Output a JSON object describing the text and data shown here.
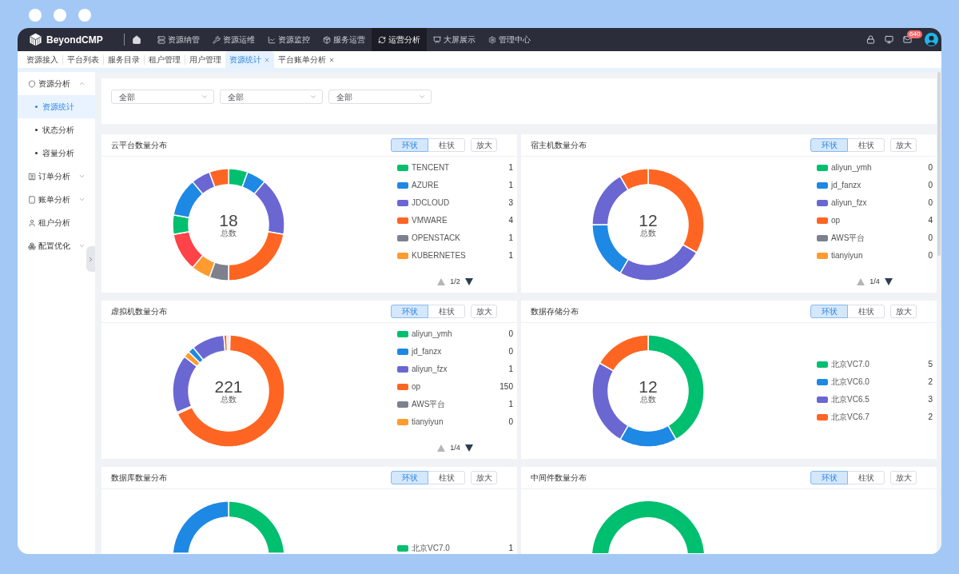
{
  "nav": {
    "logo": "BeyondCMP",
    "items": [
      {
        "label": "资源纳管",
        "selected": false
      },
      {
        "label": "资源运维",
        "selected": false
      },
      {
        "label": "资源监控",
        "selected": false
      },
      {
        "label": "服务运营",
        "selected": false
      },
      {
        "label": "运营分析",
        "selected": true
      },
      {
        "label": "大屏展示",
        "selected": false
      },
      {
        "label": "管理中心",
        "selected": false
      }
    ],
    "mail_badge": "640"
  },
  "tabs": [
    {
      "label": "资源接入",
      "selected": false,
      "closable": false
    },
    {
      "label": "平台列表",
      "selected": false,
      "closable": false
    },
    {
      "label": "服务目录",
      "selected": false,
      "closable": false
    },
    {
      "label": "租户管理",
      "selected": false,
      "closable": false
    },
    {
      "label": "用户管理",
      "selected": false,
      "closable": false
    },
    {
      "label": "资源统计",
      "selected": true,
      "closable": true
    },
    {
      "label": "平台账单分析",
      "selected": false,
      "closable": true
    }
  ],
  "sidebar": {
    "items": [
      {
        "kind": "group",
        "label": "资源分析",
        "expanded": true,
        "children": [
          {
            "label": "资源统计",
            "selected": true
          },
          {
            "label": "状态分析",
            "selected": false
          },
          {
            "label": "容量分析",
            "selected": false
          }
        ]
      },
      {
        "kind": "group",
        "label": "订单分析",
        "expanded": false
      },
      {
        "kind": "group",
        "label": "账单分析",
        "expanded": false
      },
      {
        "kind": "link",
        "label": "租户分析"
      },
      {
        "kind": "group",
        "label": "配置优化",
        "expanded": false
      }
    ]
  },
  "filters": [
    {
      "value": "全部"
    },
    {
      "value": "全部"
    },
    {
      "value": "全部"
    }
  ],
  "charts": [
    {
      "title": "云平台数量分布",
      "view_options": [
        {
          "label": "环状",
          "selected": true
        },
        {
          "label": "柱状",
          "selected": false
        }
      ],
      "zoom_button": "放大",
      "total": "18",
      "total_label": "总数",
      "legend": [
        {
          "label": "TENCENT",
          "value": "1",
          "color": "#00bf6f"
        },
        {
          "label": "AZURE",
          "value": "1",
          "color": "#1e88e5"
        },
        {
          "label": "JDCLOUD",
          "value": "3",
          "color": "#6a67d3"
        },
        {
          "label": "VMWARE",
          "value": "4",
          "color": "#ff6522"
        },
        {
          "label": "OPENSTACK",
          "value": "1",
          "color": "#7c818d"
        },
        {
          "label": "KUBERNETES",
          "value": "1",
          "color": "#ff9b2f"
        }
      ],
      "pager": {
        "text": "1/2",
        "prev_disabled": true,
        "next_disabled": false
      }
    },
    {
      "title": "宿主机数量分布",
      "view_options": [
        {
          "label": "环状",
          "selected": true
        },
        {
          "label": "柱状",
          "selected": false
        }
      ],
      "zoom_button": "放大",
      "total": "12",
      "total_label": "总数",
      "legend": [
        {
          "label": "aliyun_ymh",
          "value": "0",
          "color": "#00bf6f"
        },
        {
          "label": "jd_fanzx",
          "value": "0",
          "color": "#1e88e5"
        },
        {
          "label": "aliyun_fzx",
          "value": "0",
          "color": "#6a67d3"
        },
        {
          "label": "op",
          "value": "4",
          "color": "#ff6522"
        },
        {
          "label": "AWS平台",
          "value": "0",
          "color": "#7c818d"
        },
        {
          "label": "tianyiyun",
          "value": "0",
          "color": "#ff9b2f"
        }
      ],
      "pager": {
        "text": "1/4",
        "prev_disabled": true,
        "next_disabled": false
      }
    },
    {
      "title": "虚拟机数量分布",
      "view_options": [
        {
          "label": "环状",
          "selected": true
        },
        {
          "label": "柱状",
          "selected": false
        }
      ],
      "zoom_button": "放大",
      "total": "221",
      "total_label": "总数",
      "legend": [
        {
          "label": "aliyun_ymh",
          "value": "0",
          "color": "#00bf6f"
        },
        {
          "label": "jd_fanzx",
          "value": "0",
          "color": "#1e88e5"
        },
        {
          "label": "aliyun_fzx",
          "value": "1",
          "color": "#6a67d3"
        },
        {
          "label": "op",
          "value": "150",
          "color": "#ff6522"
        },
        {
          "label": "AWS平台",
          "value": "1",
          "color": "#7c818d"
        },
        {
          "label": "tianyiyun",
          "value": "0",
          "color": "#ff9b2f"
        }
      ],
      "pager": {
        "text": "1/4",
        "prev_disabled": true,
        "next_disabled": false
      }
    },
    {
      "title": "数据存储分布",
      "view_options": [
        {
          "label": "环状",
          "selected": true
        },
        {
          "label": "柱状",
          "selected": false
        }
      ],
      "zoom_button": "放大",
      "total": "12",
      "total_label": "总数",
      "legend": [
        {
          "label": "北京VC7.0",
          "value": "5",
          "color": "#00bf6f"
        },
        {
          "label": "北京VC6.0",
          "value": "2",
          "color": "#1e88e5"
        },
        {
          "label": "北京VC6.5",
          "value": "3",
          "color": "#6a67d3"
        },
        {
          "label": "北京VC6.7",
          "value": "2",
          "color": "#ff6522"
        }
      ]
    },
    {
      "title": "数据库数量分布",
      "view_options": [
        {
          "label": "环状",
          "selected": true
        },
        {
          "label": "柱状",
          "selected": false
        }
      ],
      "zoom_button": "放大",
      "legend": [
        {
          "label": "北京VC7.0",
          "value": "1",
          "color": "#00bf6f"
        }
      ]
    },
    {
      "title": "中间件数量分布",
      "view_options": [
        {
          "label": "环状",
          "selected": true
        },
        {
          "label": "柱状",
          "selected": false
        }
      ],
      "zoom_button": "放大"
    }
  ]
}
